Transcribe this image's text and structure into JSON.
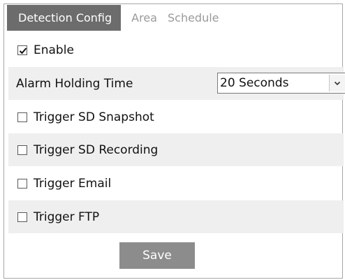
{
  "tabs": [
    {
      "label": "Detection Config",
      "active": true
    },
    {
      "label": "Area",
      "active": false
    },
    {
      "label": "Schedule",
      "active": false
    }
  ],
  "enable": {
    "label": "Enable",
    "checked": true
  },
  "alarm_holding": {
    "label": "Alarm Holding Time",
    "selected": "20 Seconds"
  },
  "triggers": [
    {
      "label": "Trigger SD Snapshot",
      "checked": false
    },
    {
      "label": "Trigger SD Recording",
      "checked": false
    },
    {
      "label": "Trigger Email",
      "checked": false
    },
    {
      "label": "Trigger FTP",
      "checked": false
    }
  ],
  "save_label": "Save",
  "colors": {
    "active_tab_bg": "#6c6c6c",
    "inactive_tab_text": "#9a9a9a",
    "shaded_row": "#efefef",
    "save_button": "#8c8c8c"
  },
  "icons": {
    "dropdown": "chevron-down-icon",
    "checkbox": "checkbox-icon"
  }
}
